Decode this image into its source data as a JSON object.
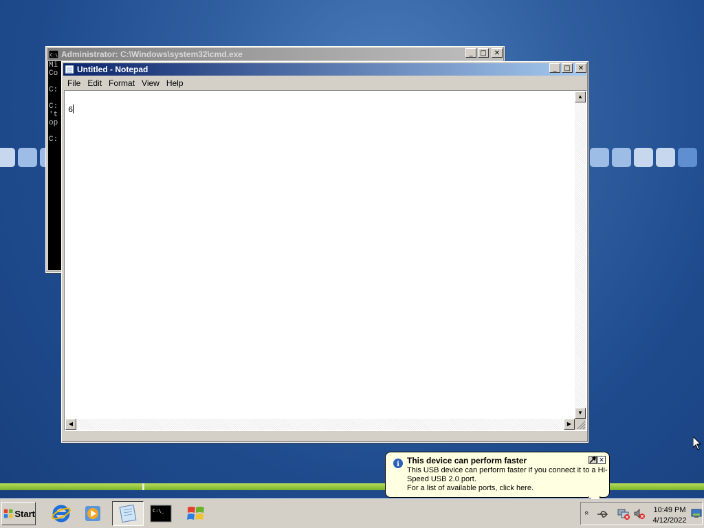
{
  "desktop": {
    "tile_colors": [
      "#c7d8ee",
      "#9dbde6",
      "#5f8fd0"
    ],
    "accent_green": "#8cc63f"
  },
  "cmd_window": {
    "title": "Administrator: C:\\Windows\\system32\\cmd.exe",
    "icon": "cmd-icon",
    "visible_lines": [
      "Mi",
      "Co",
      "",
      "C:",
      "",
      "C:",
      "'t",
      "op",
      "",
      "C:"
    ]
  },
  "notepad": {
    "title": "Untitled - Notepad",
    "icon": "notepad-icon",
    "menu": [
      "File",
      "Edit",
      "Format",
      "View",
      "Help"
    ],
    "content": "6"
  },
  "window_controls": {
    "minimize": "_",
    "maximize": "□",
    "close": "✕"
  },
  "taskbar": {
    "start_label": "Start",
    "quick_launch": [
      "internet-explorer-icon",
      "media-player-icon"
    ],
    "tasks": [
      {
        "name": "Notepad",
        "icon": "notepad-icon",
        "active": true
      },
      {
        "name": "Command Prompt",
        "icon": "cmd-icon",
        "active": false
      },
      {
        "name": "Windows Explorer",
        "icon": "windows-flag-icon",
        "active": false
      }
    ]
  },
  "tray": {
    "show_hidden": "«",
    "icons": [
      "usb-device-icon",
      "network-disconnected-icon",
      "volume-muted-icon",
      "show-desktop-icon"
    ],
    "time": "10:49 PM",
    "date": "4/12/2022"
  },
  "balloon": {
    "title": "This device can perform faster",
    "body_line1": "This USB device can perform faster if you connect it to a Hi-Speed USB 2.0 port.",
    "body_line2": "For a list of available ports, click here.",
    "close_label": "✕",
    "icon": "info-icon"
  }
}
